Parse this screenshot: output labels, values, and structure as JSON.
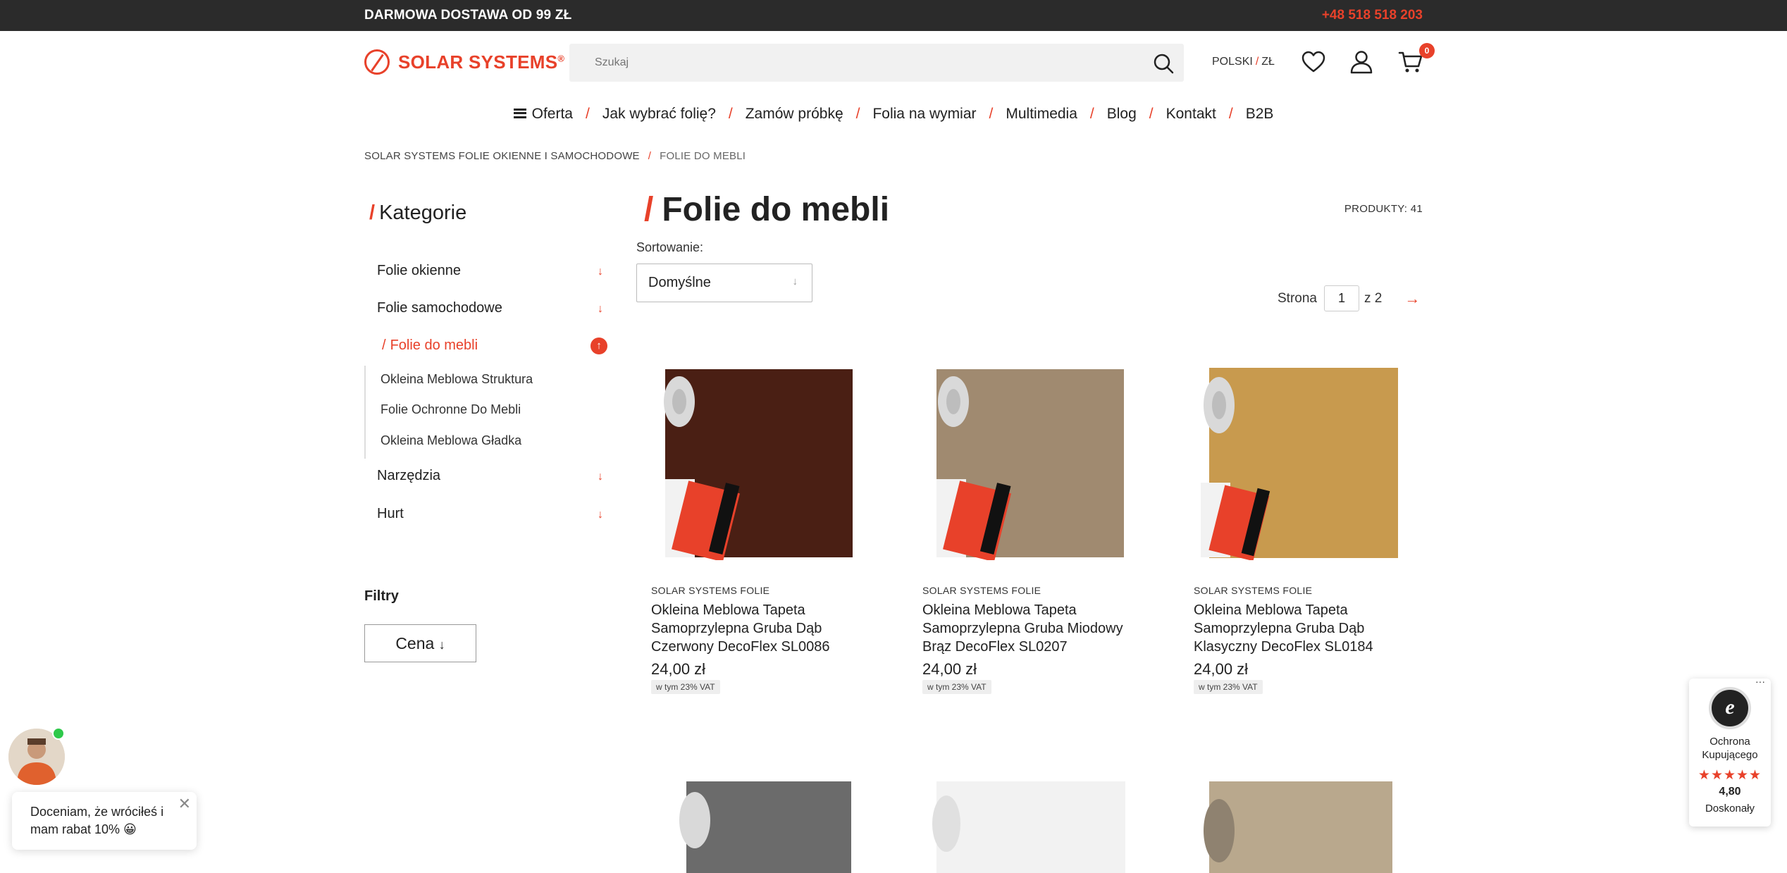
{
  "topbar": {
    "promo": "DARMOWA DOSTAWA OD 99 ZŁ",
    "phone": "+48 518 518 203"
  },
  "header": {
    "logo_text": "SOLAR SYSTEMS",
    "logo_reg": "®",
    "search_placeholder": "Szukaj",
    "language": "POLSKI",
    "currency": "ZŁ",
    "cart_count": "0"
  },
  "nav": {
    "items": [
      "Oferta",
      "Jak wybrać folię?",
      "Zamów próbkę",
      "Folia na wymiar",
      "Multimedia",
      "Blog",
      "Kontakt",
      "B2B"
    ],
    "separator": "/"
  },
  "breadcrumb": {
    "home": "SOLAR SYSTEMS FOLIE OKIENNE I SAMOCHODOWE",
    "current": "FOLIE DO MEBLI"
  },
  "sidebar": {
    "title": "Kategorie",
    "categories": [
      "Folie okienne",
      "Folie samochodowe",
      "Folie do mebli",
      "Narzędzia",
      "Hurt"
    ],
    "subcategories": [
      "Okleina Meblowa Struktura",
      "Folie Ochronne Do Mebli",
      "Okleina Meblowa Gładka"
    ],
    "filters_title": "Filtry",
    "filter_price": "Cena"
  },
  "main": {
    "title": "Folie do mebli",
    "product_count": "PRODUKTY: 41",
    "sort_label": "Sortowanie:",
    "sort_value": "Domyślne",
    "pager_label": "Strona",
    "pager_current": "1",
    "pager_total": "z 2"
  },
  "products": [
    {
      "brand": "SOLAR SYSTEMS FOLIE",
      "name": "Okleina Meblowa Tapeta Samoprzylepna Gruba Dąb Czerwony DecoFlex SL0086",
      "price": "24,00 zł",
      "vat": "w tym 23% VAT",
      "color": "#4a1f14"
    },
    {
      "brand": "SOLAR SYSTEMS FOLIE",
      "name": "Okleina Meblowa Tapeta Samoprzylepna Gruba Miodowy Brąz DecoFlex SL0207",
      "price": "24,00 zł",
      "vat": "w tym 23% VAT",
      "color": "#a08a70"
    },
    {
      "brand": "SOLAR SYSTEMS FOLIE",
      "name": "Okleina Meblowa Tapeta Samoprzylepna Gruba Dąb Klasyczny DecoFlex SL0184",
      "price": "24,00 zł",
      "vat": "w tym 23% VAT",
      "color": "#c89a4e"
    }
  ],
  "products_row2_colors": [
    "#6b6b6b",
    "#f2f2f2",
    "#b9a88d"
  ],
  "chat": {
    "message": "Doceniam, że wróciłeś i mam rabat 10% 😀"
  },
  "trusted_badge": {
    "title": "Ochrona Kupującego",
    "stars": "★★★★★",
    "score": "4,80",
    "rating": "Doskonały"
  },
  "colors": {
    "accent": "#e8412a",
    "topbar": "#2b2b2b"
  }
}
